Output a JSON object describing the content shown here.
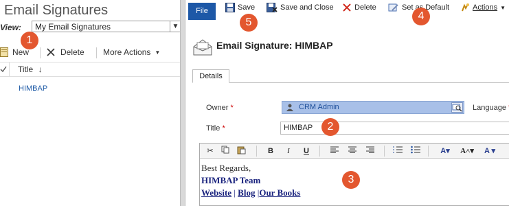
{
  "left": {
    "title": "Email Signatures",
    "view_label": "View:",
    "view_value": "My Email Signatures",
    "toolbar": {
      "new": "New",
      "delete": "Delete",
      "more_actions": "More Actions"
    },
    "column_title": "Title",
    "rows": [
      "HIMBAP"
    ]
  },
  "ribbon": {
    "file": "File",
    "save": "Save",
    "save_close": "Save and Close",
    "delete": "Delete",
    "set_default": "Set as Default",
    "actions": "Actions"
  },
  "form": {
    "title": "Email Signature: HIMBAP",
    "tab": "Details",
    "owner_label": "Owner",
    "owner_value": "CRM Admin",
    "language_label": "Language",
    "title_label": "Title",
    "title_value": "HIMBAP",
    "required_mark": "*"
  },
  "editor": {
    "toolbar": {
      "bold": "B",
      "italic": "I",
      "underline": "U"
    },
    "line1": "Best Regards,",
    "line2": "HIMBAP Team",
    "links": [
      "Website",
      "Blog",
      "Our Books"
    ],
    "separator": "|"
  },
  "callouts": [
    "1",
    "2",
    "3",
    "4",
    "5"
  ],
  "colors": {
    "accent": "#1d58a7",
    "callout": "#e3572f",
    "owner_bg": "#a8c0e8",
    "link": "#1e5aa6"
  }
}
